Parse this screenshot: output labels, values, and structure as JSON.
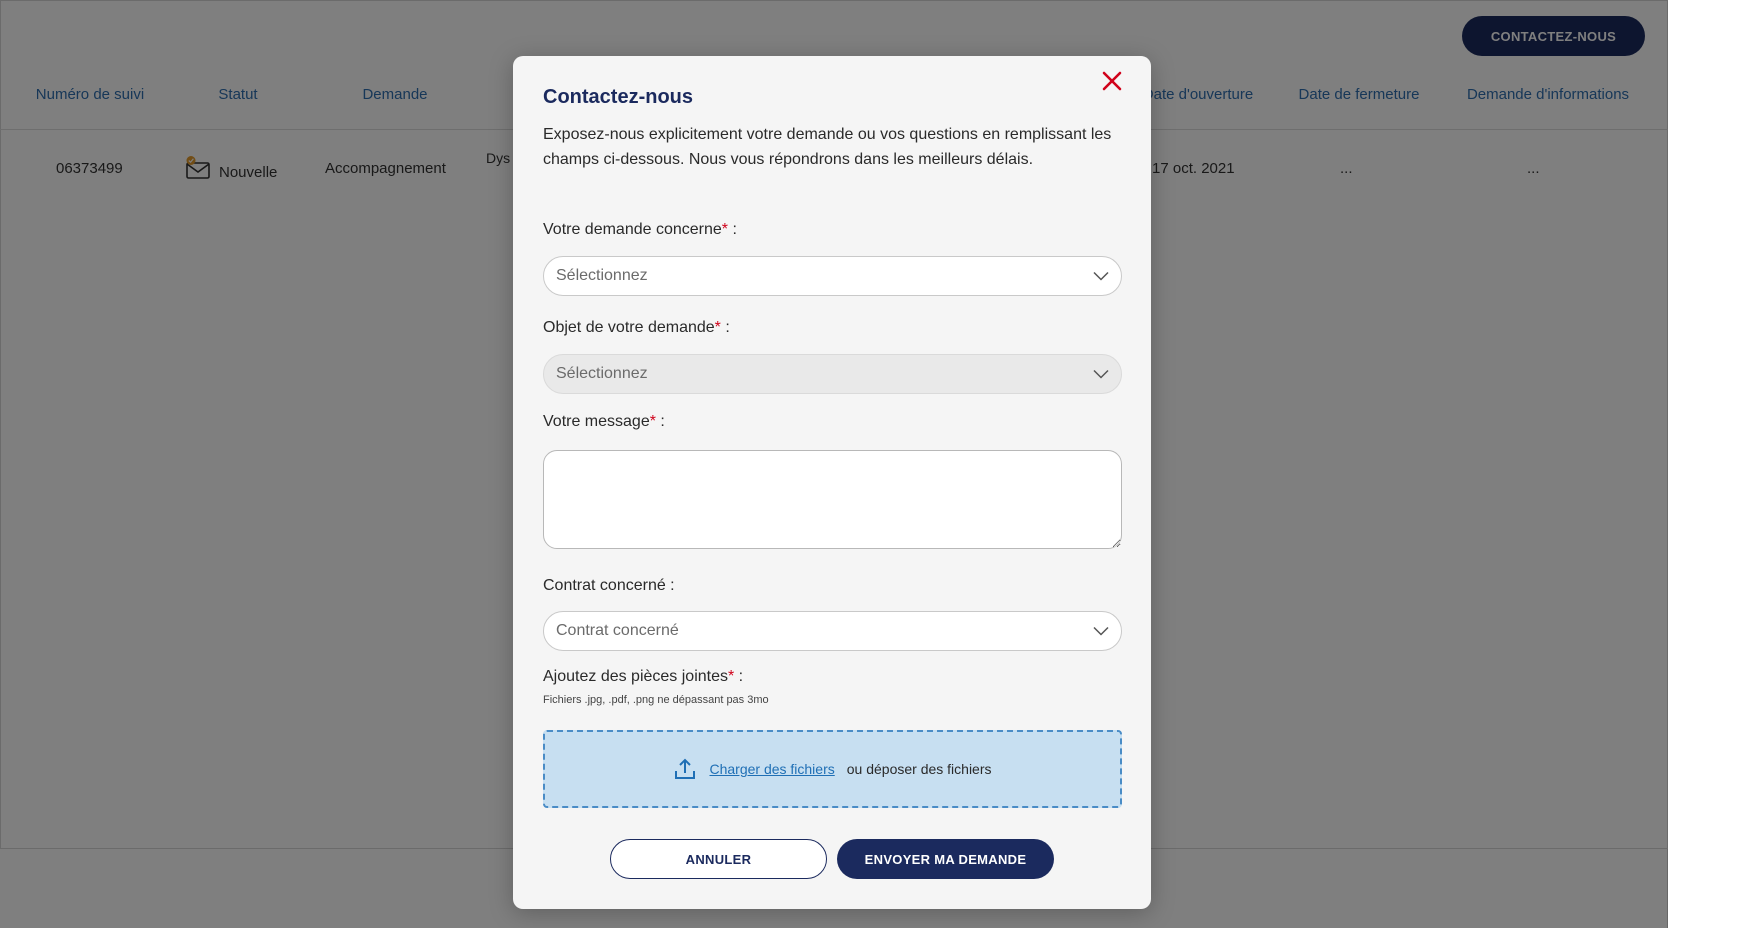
{
  "page": {
    "cta_label": "CONTACTEZ-NOUS",
    "table": {
      "headers": [
        "Numéro de suivi",
        "Statut",
        "Demande",
        "Date d'ouverture",
        "Date de fermeture",
        "Demande d'informations"
      ],
      "row": {
        "tracking": "06373499",
        "status": "Nouvelle",
        "demande": "Accompagnement",
        "partial_text": "Dys",
        "opening_date": "17 oct. 2021",
        "closing_date": "...",
        "info_request": "..."
      }
    }
  },
  "modal": {
    "title": "Contactez-nous",
    "intro": "Exposez-nous explicitement votre demande ou vos questions en remplissant les champs ci-dessous. Nous vous répondrons dans les meilleurs délais.",
    "required_mark": "*",
    "colon": " :",
    "field_concern": {
      "label": "Votre demande concerne",
      "value": "Sélectionnez"
    },
    "field_object": {
      "label": "Objet de votre demande",
      "value": "Sélectionnez"
    },
    "field_message": {
      "label": "Votre message"
    },
    "field_contract": {
      "label": "Contrat concerné :",
      "value": "Contrat concerné"
    },
    "attachments": {
      "label": "Ajoutez des pièces jointes",
      "hint": "Fichiers .jpg, .pdf, .png ne dépassant pas 3mo",
      "upload_link": "Charger des fichiers",
      "drop_text": "ou déposer des fichiers"
    },
    "cancel_label": "ANNULER",
    "send_label": "ENVOYER MA DEMANDE"
  },
  "colors": {
    "brand_navy": "#1b2a5e",
    "link_blue": "#2f6fb0",
    "required_red": "#d0021b",
    "dropzone_fill": "#c7dff1"
  }
}
